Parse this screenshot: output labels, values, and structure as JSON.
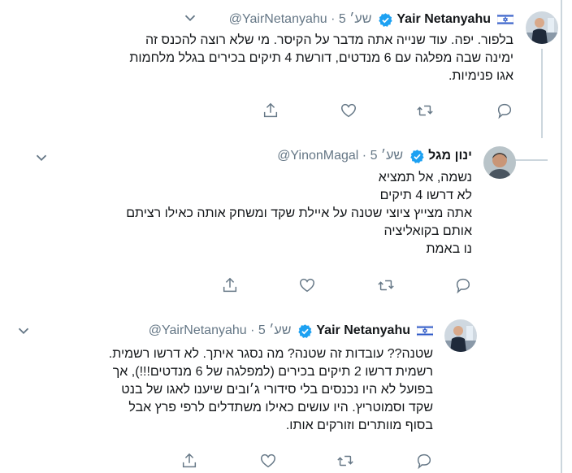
{
  "tweets": [
    {
      "name": "Yair Netanyahu",
      "handle": "@YairNetanyahu",
      "time": "5 שע׳",
      "lines": [
        "בלפור. יפה. עוד שנייה אתה מדבר על הקיסר. מי שלא רוצה להכנס זה",
        "ימינה שבה מפלגה עם 6 מנדטים, דורשת 4 תיקים בכירים בגלל מלחמות",
        "אגו פנימיות."
      ],
      "has_flag": true
    },
    {
      "name": "ינון מגל",
      "handle": "@YinonMagal",
      "time": "5 שע׳",
      "lines": [
        "נשמה, אל תמציא",
        "לא דרשו 4 תיקים",
        "אתה מצייץ ציוצי שטנה על איילת שקד ומשחק אותה כאילו רציתם",
        "אותם בקואליציה",
        "נו באמת"
      ],
      "has_flag": false
    },
    {
      "name": "Yair Netanyahu",
      "handle": "@YairNetanyahu",
      "time": "5 שע׳",
      "lines": [
        "שטנה?? עובדות זה שטנה? מה נסגר איתך. לא דרשו רשמית.",
        "רשמית דרשו 2 תיקים בכירים (למפלגה של 6 מנדטים!!!), אך",
        "בפועל לא היו נכנסים בלי סידורי ג׳ובים שיענו לאגו של בנט",
        "שקד וסמוטריץ. היו עושים כאילו משתדלים לרפי פרץ אבל",
        "בסוף מוותרים וזורקים אותו."
      ],
      "has_flag": true
    }
  ],
  "icons": [
    "more-icon",
    "share-icon",
    "like-icon",
    "retweet-icon",
    "reply-icon",
    "verified-icon",
    "israel-flag-icon"
  ],
  "colors": {
    "text": "#14171a",
    "secondary": "#657786",
    "verified": "#1da1f2",
    "line": "#ccd6dd"
  }
}
